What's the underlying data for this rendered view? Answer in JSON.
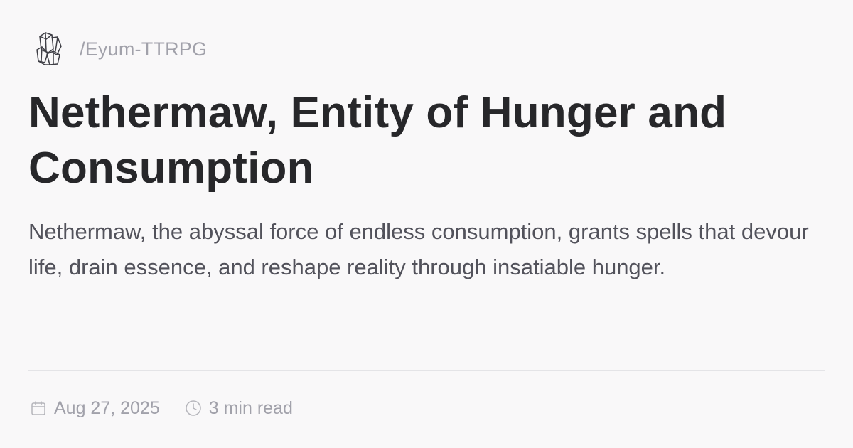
{
  "site": {
    "logo_icon": "crystal-cluster-icon",
    "path": "/Eyum-TTRPG"
  },
  "article": {
    "title": "Nethermaw, Entity of Hunger and Consumption",
    "description": "Nethermaw, the abyssal force of endless consumption, grants spells that devour life, drain essence, and reshape reality through insatiable hunger."
  },
  "meta": {
    "date_icon": "calendar-icon",
    "date": "Aug 27, 2025",
    "read_time_icon": "clock-icon",
    "read_time": "3 min read"
  },
  "colors": {
    "background": "#f9f8f9",
    "title": "#27272a",
    "description": "#52525b",
    "muted": "#a1a1aa",
    "divider": "#e4e4e7"
  }
}
